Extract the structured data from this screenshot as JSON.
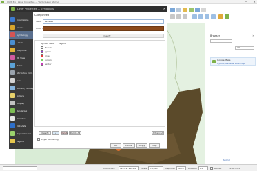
{
  "app": {
    "title": "QGIS 3.x · Layer Properties — Vector Layer Styling",
    "win_controls": [
      "—",
      "□",
      "✕"
    ]
  },
  "dialog": {
    "title": "Layer Properties — Symbology",
    "section": "Categorized",
    "name_label": "Value",
    "name_value": "landuse",
    "color_label": "Color ramp",
    "header_text": "Classify",
    "list_headers": [
      "Symbol",
      "Value",
      "Legend"
    ],
    "rows": [
      {
        "color": "#e8e8e8",
        "label": "forest"
      },
      {
        "color": "#9c3bd6",
        "label": "grass"
      },
      {
        "color": "#e23b3b",
        "label": "river"
      },
      {
        "color": "#7bd05f",
        "label": "urban"
      },
      {
        "color": "#c43bb6",
        "label": "water"
      }
    ],
    "buttons": {
      "classify": "Classify",
      "delete": "Delete",
      "delete_all": "Delete All",
      "advanced": "Advanced",
      "ok": "OK",
      "cancel": "Cancel",
      "apply": "Apply",
      "help": "Help"
    },
    "layer_rendering_label": "Layer Rendering"
  },
  "sidebar": {
    "items": [
      {
        "label": "Information",
        "color": "#3d7bd1"
      },
      {
        "label": "Source",
        "color": "#d9a52b"
      },
      {
        "label": "Symbology",
        "color": "#d65454"
      },
      {
        "label": "Labels",
        "color": "#4a8fd1"
      },
      {
        "label": "Diagrams",
        "color": "#e0b238"
      },
      {
        "label": "3D View",
        "color": "#d25ba0"
      },
      {
        "label": "Fields",
        "color": "#5ba2d6"
      },
      {
        "label": "Attributes Form",
        "color": "#9aa3ad"
      },
      {
        "label": "Joins",
        "color": "#d4d4d4"
      },
      {
        "label": "Auxiliary Storage",
        "color": "#86b4de"
      },
      {
        "label": "Actions",
        "color": "#e7d16b"
      },
      {
        "label": "Display",
        "color": "#c2c2c2"
      },
      {
        "label": "Rendering",
        "color": "#7dbd54"
      },
      {
        "label": "Variables",
        "color": "#e6e6e6"
      },
      {
        "label": "Metadata",
        "color": "#2e6fc9"
      },
      {
        "label": "Dependencies",
        "color": "#9bd36d"
      },
      {
        "label": "Legend",
        "color": "#e5c64d"
      }
    ]
  },
  "right_panel": {
    "title": "Browser",
    "close": "✕",
    "combo": "All",
    "item_title": "Google Maps",
    "item_link": "Hybrid, Satellite, Roadmap",
    "bottom_link": "Tutorial"
  },
  "statusbar": {
    "coordinate_label": "Coordinate",
    "coordinate_value": "1213.1, 1021.4",
    "scale_label": "Scale",
    "scale_value": "1:9,083",
    "magnifier_label": "Magnifier",
    "magnifier_value": "100%",
    "rotation_label": "Rotation",
    "rotation_value": "0.0 °",
    "render_label": "Render",
    "crs": "EPSG:4326"
  },
  "colors": {
    "map_bg": "#d9ecd6",
    "forest": "#5b4a2a",
    "color_ramp": "#8b4a1c",
    "sidebar_bg": "#3a3a3a",
    "active_item": "#5a6f8e"
  }
}
